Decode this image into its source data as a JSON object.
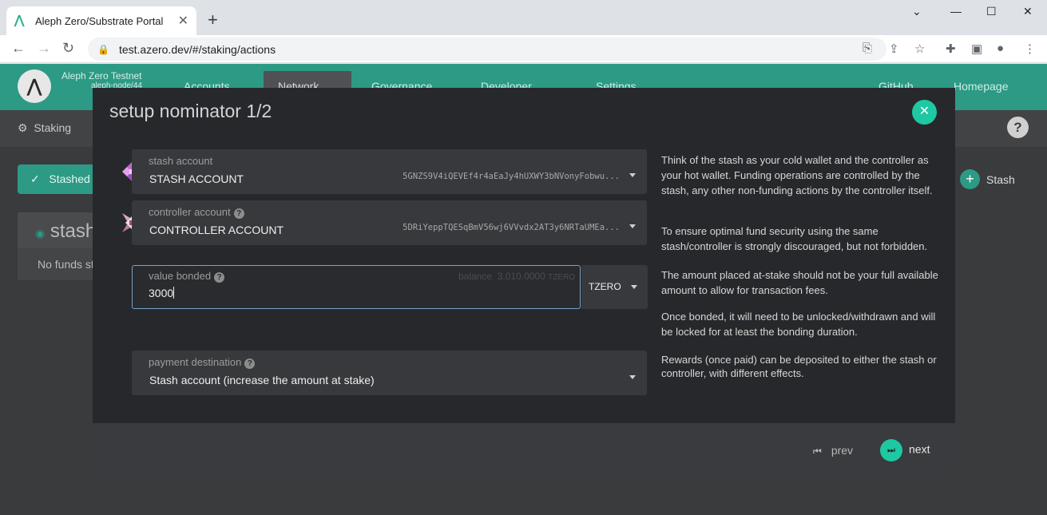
{
  "browser": {
    "tab_title": "Aleph Zero/Substrate Portal",
    "url": "test.azero.dev/#/staking/actions"
  },
  "app": {
    "chain_name": "Aleph Zero Testnet",
    "node": "aleph-node/44",
    "menu": [
      "Accounts",
      "Network",
      "Governance",
      "Developer",
      "Settings"
    ],
    "links": [
      "GitHub",
      "Homepage"
    ],
    "section": "Staking",
    "stashed_tab": "Stashed",
    "stash_button": "Stash",
    "card_title": "stash",
    "no_funds": "No funds st"
  },
  "modal": {
    "title": "setup nominator 1/2",
    "stash": {
      "label": "stash account",
      "name": "STASH ACCOUNT",
      "address": "5GNZS9V4iQEVEf4r4aEaJy4hUXWY3bNVonyFobwu..."
    },
    "controller": {
      "label": "controller account",
      "name": "CONTROLLER ACCOUNT",
      "address": "5DRiYeppTQESqBmV56wj6VVvdx2AT3y6NRTaUMEa..."
    },
    "value_bonded": {
      "label": "value bonded",
      "balance_label": "balance",
      "balance_value": "3,010",
      "balance_decimals": ".0000",
      "balance_unit": "TZERO",
      "value": "3000",
      "unit": "TZERO"
    },
    "payment": {
      "label": "payment destination",
      "value": "Stash account (increase the amount at stake)"
    },
    "help": {
      "stash_p1": "Think of the stash as your cold wallet and the controller as your hot wallet. Funding operations are controlled by the stash, any other non-funding actions by the controller itself.",
      "stash_p2": "To ensure optimal fund security using the same stash/controller is strongly discouraged, but not forbidden.",
      "value_p1": "The amount placed at-stake should not be your full available amount to allow for transaction fees.",
      "value_p2": "Once bonded, it will need to be unlocked/withdrawn and will be locked for at least the bonding duration.",
      "payment_p1": "Rewards (once paid) can be deposited to either the stash or controller, with different effects."
    },
    "prev_label": "prev",
    "next_label": "next"
  },
  "colors": {
    "accent": "#1ec8a2",
    "header": "#2c9a85"
  }
}
